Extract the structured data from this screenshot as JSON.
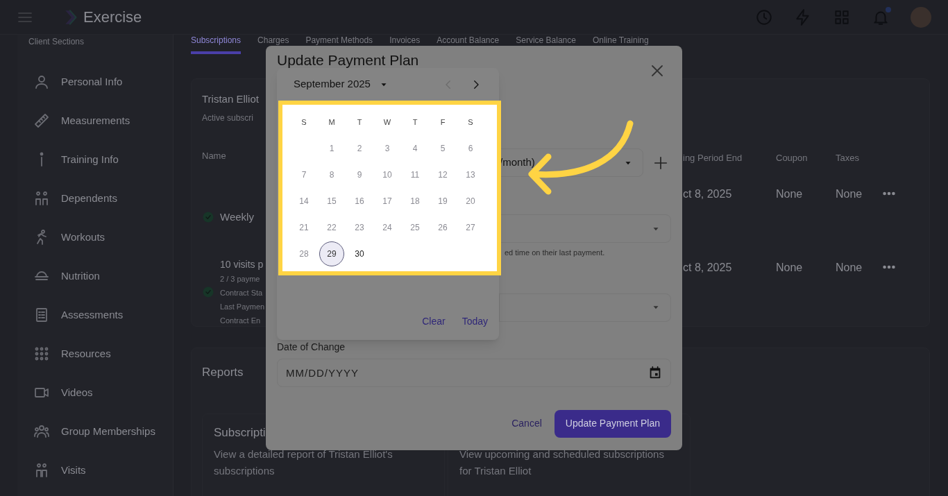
{
  "header": {
    "app_name": "Exercise",
    "has_notification": true
  },
  "sidebar": {
    "title": "Client Sections",
    "items": [
      {
        "label": "Personal Info"
      },
      {
        "label": "Measurements"
      },
      {
        "label": "Training Info"
      },
      {
        "label": "Dependents"
      },
      {
        "label": "Workouts"
      },
      {
        "label": "Nutrition"
      },
      {
        "label": "Assessments"
      },
      {
        "label": "Resources"
      },
      {
        "label": "Videos"
      },
      {
        "label": "Group Memberships"
      },
      {
        "label": "Visits"
      }
    ]
  },
  "tabs": [
    {
      "label": "Subscriptions",
      "selected": true
    },
    {
      "label": "Charges",
      "selected": false
    },
    {
      "label": "Payment Methods",
      "selected": false
    },
    {
      "label": "Invoices",
      "selected": false
    },
    {
      "label": "Account Balance",
      "selected": false
    },
    {
      "label": "Service Balance",
      "selected": false
    },
    {
      "label": "Online Training",
      "selected": false
    }
  ],
  "subscriptions": {
    "title": "Tristan Elliot",
    "subtitle": "Active subscri",
    "columns": [
      "Name",
      "ing Period End",
      "Coupon",
      "Taxes"
    ],
    "rows": [
      {
        "name": "Weekly",
        "details": [],
        "active": true,
        "period_end": "ct 8, 2025",
        "coupon": "None",
        "taxes": "None"
      },
      {
        "name": "10 visits p",
        "details": [
          "2 / 3 payme",
          "Contract Sta",
          "Last Paymen",
          "Contract En"
        ],
        "active": true,
        "period_end": "ct 8, 2025",
        "coupon": "None",
        "taxes": "None"
      }
    ]
  },
  "reports": {
    "title": "Reports",
    "cards": [
      {
        "title": "Subscripti",
        "description": "View a detailed report of Tristan Elliot's subscriptions"
      },
      {
        "description": "View upcoming and scheduled subscriptions for Tristan Elliot"
      }
    ]
  },
  "modal": {
    "title": "Update Payment Plan",
    "plan_select": {
      "value": "/month)"
    },
    "helper_text": "ed time on their last payment.",
    "date_of_change": {
      "label": "Date of Change",
      "placeholder": "MM/DD/YYYY"
    },
    "buttons": [
      {
        "label": "Cancel",
        "kind": "text"
      },
      {
        "label": "Update Payment Plan",
        "kind": "primary"
      }
    ]
  },
  "date_picker": {
    "month": "September 2025",
    "prev_disabled": true,
    "weekdays": [
      "S",
      "M",
      "T",
      "W",
      "T",
      "F",
      "S"
    ],
    "weeks": [
      [
        {
          "day": "1",
          "disabled": true,
          "selected": false
        },
        {
          "day": "2",
          "disabled": true,
          "selected": false
        },
        {
          "day": "3",
          "disabled": true,
          "selected": false
        },
        {
          "day": "4",
          "disabled": true,
          "selected": false
        },
        {
          "day": "5",
          "disabled": true,
          "selected": false
        },
        {
          "day": "6",
          "disabled": true,
          "selected": false
        }
      ],
      [
        {
          "day": "7",
          "disabled": true,
          "selected": false
        },
        {
          "day": "8",
          "disabled": true,
          "selected": false
        },
        {
          "day": "9",
          "disabled": true,
          "selected": false
        },
        {
          "day": "10",
          "disabled": true,
          "selected": false
        },
        {
          "day": "11",
          "disabled": true,
          "selected": false
        },
        {
          "day": "12",
          "disabled": true,
          "selected": false
        },
        {
          "day": "13",
          "disabled": true,
          "selected": false
        }
      ],
      [
        {
          "day": "14",
          "disabled": true,
          "selected": false
        },
        {
          "day": "15",
          "disabled": true,
          "selected": false
        },
        {
          "day": "16",
          "disabled": true,
          "selected": false
        },
        {
          "day": "17",
          "disabled": true,
          "selected": false
        },
        {
          "day": "18",
          "disabled": true,
          "selected": false
        },
        {
          "day": "19",
          "disabled": true,
          "selected": false
        },
        {
          "day": "20",
          "disabled": true,
          "selected": false
        }
      ],
      [
        {
          "day": "21",
          "disabled": true,
          "selected": false
        },
        {
          "day": "22",
          "disabled": true,
          "selected": false
        },
        {
          "day": "23",
          "disabled": true,
          "selected": false
        },
        {
          "day": "24",
          "disabled": true,
          "selected": false
        },
        {
          "day": "25",
          "disabled": true,
          "selected": false
        },
        {
          "day": "26",
          "disabled": true,
          "selected": false
        },
        {
          "day": "27",
          "disabled": true,
          "selected": false
        }
      ],
      [
        {
          "day": "28",
          "disabled": true,
          "selected": false
        },
        {
          "day": "29",
          "disabled": false,
          "selected": true
        },
        {
          "day": "30",
          "disabled": false,
          "selected": false
        }
      ]
    ],
    "actions": [
      "Clear",
      "Today"
    ]
  }
}
